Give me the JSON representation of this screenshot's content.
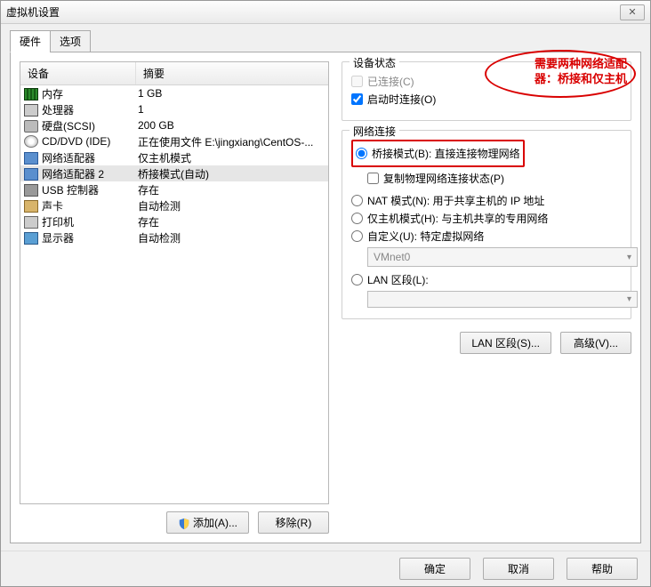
{
  "window": {
    "title": "虚拟机设置"
  },
  "tabs": {
    "hardware": "硬件",
    "options": "选项"
  },
  "list": {
    "header": {
      "device": "设备",
      "summary": "摘要"
    },
    "items": [
      {
        "name": "内存",
        "summary": "1 GB",
        "icon": "memory"
      },
      {
        "name": "处理器",
        "summary": "1",
        "icon": "cpu"
      },
      {
        "name": "硬盘(SCSI)",
        "summary": "200 GB",
        "icon": "hdd"
      },
      {
        "name": "CD/DVD (IDE)",
        "summary": "正在使用文件 E:\\jingxiang\\CentOS-...",
        "icon": "cd"
      },
      {
        "name": "网络适配器",
        "summary": "仅主机模式",
        "icon": "net"
      },
      {
        "name": "网络适配器 2",
        "summary": "桥接模式(自动)",
        "icon": "net",
        "selected": true
      },
      {
        "name": "USB 控制器",
        "summary": "存在",
        "icon": "usb"
      },
      {
        "name": "声卡",
        "summary": "自动检测",
        "icon": "sound"
      },
      {
        "name": "打印机",
        "summary": "存在",
        "icon": "printer"
      },
      {
        "name": "显示器",
        "summary": "自动检测",
        "icon": "monitor"
      }
    ]
  },
  "left_buttons": {
    "add": "添加(A)...",
    "remove": "移除(R)"
  },
  "device_status": {
    "title": "设备状态",
    "connected": "已连接(C)",
    "connect_at_power_on": "启动时连接(O)"
  },
  "annotation": {
    "line1": "需要两种网络适配",
    "line2": "器：桥接和仅主机"
  },
  "network": {
    "title": "网络连接",
    "bridged": "桥接模式(B): 直接连接物理网络",
    "replicate": "复制物理网络连接状态(P)",
    "nat": "NAT 模式(N): 用于共享主机的 IP 地址",
    "hostonly": "仅主机模式(H): 与主机共享的专用网络",
    "custom": "自定义(U): 特定虚拟网络",
    "custom_value": "VMnet0",
    "lan_segment": "LAN 区段(L):",
    "lan_value": ""
  },
  "right_buttons": {
    "lan": "LAN 区段(S)...",
    "advanced": "高级(V)..."
  },
  "footer": {
    "ok": "确定",
    "cancel": "取消",
    "help": "帮助"
  }
}
